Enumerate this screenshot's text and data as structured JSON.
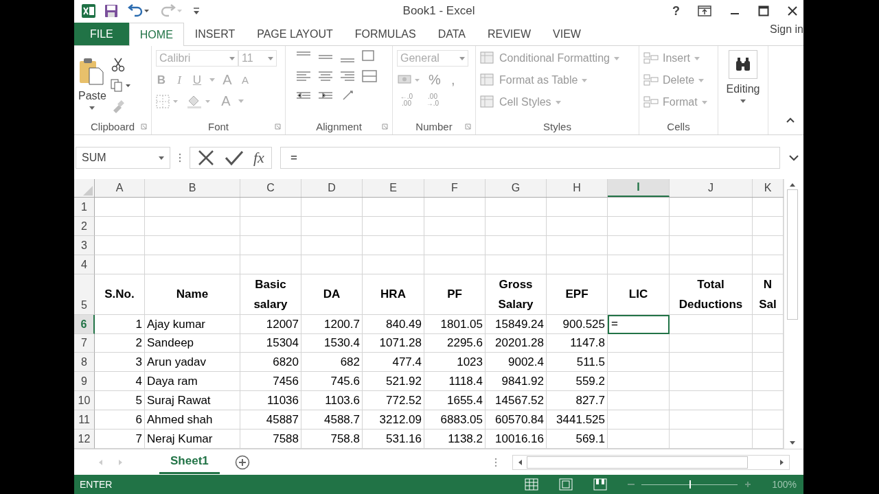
{
  "window": {
    "title": "Book1 - Excel",
    "help": "?"
  },
  "tabs": [
    {
      "label": "FILE",
      "kind": "file",
      "selected": false
    },
    {
      "label": "HOME",
      "kind": "tab",
      "selected": true
    },
    {
      "label": "INSERT",
      "kind": "tab",
      "selected": false
    },
    {
      "label": "PAGE LAYOUT",
      "kind": "tab",
      "selected": false
    },
    {
      "label": "FORMULAS",
      "kind": "tab",
      "selected": false
    },
    {
      "label": "DATA",
      "kind": "tab",
      "selected": false
    },
    {
      "label": "REVIEW",
      "kind": "tab",
      "selected": false
    },
    {
      "label": "VIEW",
      "kind": "tab",
      "selected": false
    }
  ],
  "sign_in": "Sign in",
  "ribbon": {
    "clipboard": {
      "label": "Clipboard",
      "paste": "Paste"
    },
    "font": {
      "label": "Font",
      "font_name": "Calibri",
      "font_size": "11",
      "bold": "B",
      "italic": "I",
      "underline": "U",
      "grow": "A",
      "shrink": "A",
      "font_color_button": "A"
    },
    "alignment": {
      "label": "Alignment"
    },
    "number": {
      "label": "Number",
      "format": "General",
      "percent": "%",
      "comma": ",",
      "increase": "←.0 .00",
      "decrease": ".00 →.0"
    },
    "styles": {
      "label": "Styles",
      "items": [
        "Conditional Formatting",
        "Format as Table",
        "Cell Styles"
      ]
    },
    "cells": {
      "label": "Cells",
      "items": [
        "Insert",
        "Delete",
        "Format"
      ]
    },
    "editing": {
      "label": "Editing"
    }
  },
  "formula_bar": {
    "name_box": "SUM",
    "fx": "fx",
    "formula": "="
  },
  "columns": [
    {
      "label": "A",
      "selected": false
    },
    {
      "label": "B",
      "selected": false
    },
    {
      "label": "C",
      "selected": false
    },
    {
      "label": "D",
      "selected": false
    },
    {
      "label": "E",
      "selected": false
    },
    {
      "label": "F",
      "selected": false
    },
    {
      "label": "G",
      "selected": false
    },
    {
      "label": "H",
      "selected": false
    },
    {
      "label": "I",
      "selected": true
    },
    {
      "label": "J",
      "selected": false
    },
    {
      "label": "K",
      "selected": false
    }
  ],
  "rows": [
    {
      "number": "1",
      "selected": false
    },
    {
      "number": "2",
      "selected": false
    },
    {
      "number": "3",
      "selected": false
    },
    {
      "number": "4",
      "selected": false
    },
    {
      "number": "5",
      "selected": false,
      "kind": "header",
      "cells": [
        "S.No.",
        "Name",
        "Basic salary",
        "DA",
        "HRA",
        "PF",
        "Gross Salary",
        "EPF",
        "LIC",
        "Total Deductions",
        "N Sal"
      ]
    },
    {
      "number": "6",
      "selected": true,
      "kind": "data",
      "cells": [
        "1",
        "Ajay kumar",
        "12007",
        "1200.7",
        "840.49",
        "1801.05",
        "15849.24",
        "900.525",
        "="
      ]
    },
    {
      "number": "7",
      "selected": false,
      "kind": "data",
      "cells": [
        "2",
        "Sandeep",
        "15304",
        "1530.4",
        "1071.28",
        "2295.6",
        "20201.28",
        "1147.8"
      ]
    },
    {
      "number": "8",
      "selected": false,
      "kind": "data",
      "cells": [
        "3",
        "Arun yadav",
        "6820",
        "682",
        "477.4",
        "1023",
        "9002.4",
        "511.5"
      ]
    },
    {
      "number": "9",
      "selected": false,
      "kind": "data",
      "cells": [
        "4",
        "Daya ram",
        "7456",
        "745.6",
        "521.92",
        "1118.4",
        "9841.92",
        "559.2"
      ]
    },
    {
      "number": "10",
      "selected": false,
      "kind": "data",
      "cells": [
        "5",
        "Suraj Rawat",
        "11036",
        "1103.6",
        "772.52",
        "1655.4",
        "14567.52",
        "827.7"
      ]
    },
    {
      "number": "11",
      "selected": false,
      "kind": "data",
      "cells": [
        "6",
        "Ahmed shah",
        "45887",
        "4588.7",
        "3212.09",
        "6883.05",
        "60570.84",
        "3441.525"
      ]
    },
    {
      "number": "12",
      "selected": false,
      "kind": "data",
      "cells": [
        "7",
        "Neraj Kumar",
        "7588",
        "758.8",
        "531.16",
        "1138.2",
        "10016.16",
        "569.1"
      ]
    }
  ],
  "sheets": [
    {
      "label": "Sheet1",
      "selected": true
    }
  ],
  "status_bar": {
    "mode": "ENTER",
    "zoom": {
      "level": 0.5,
      "reading": "100%"
    }
  }
}
